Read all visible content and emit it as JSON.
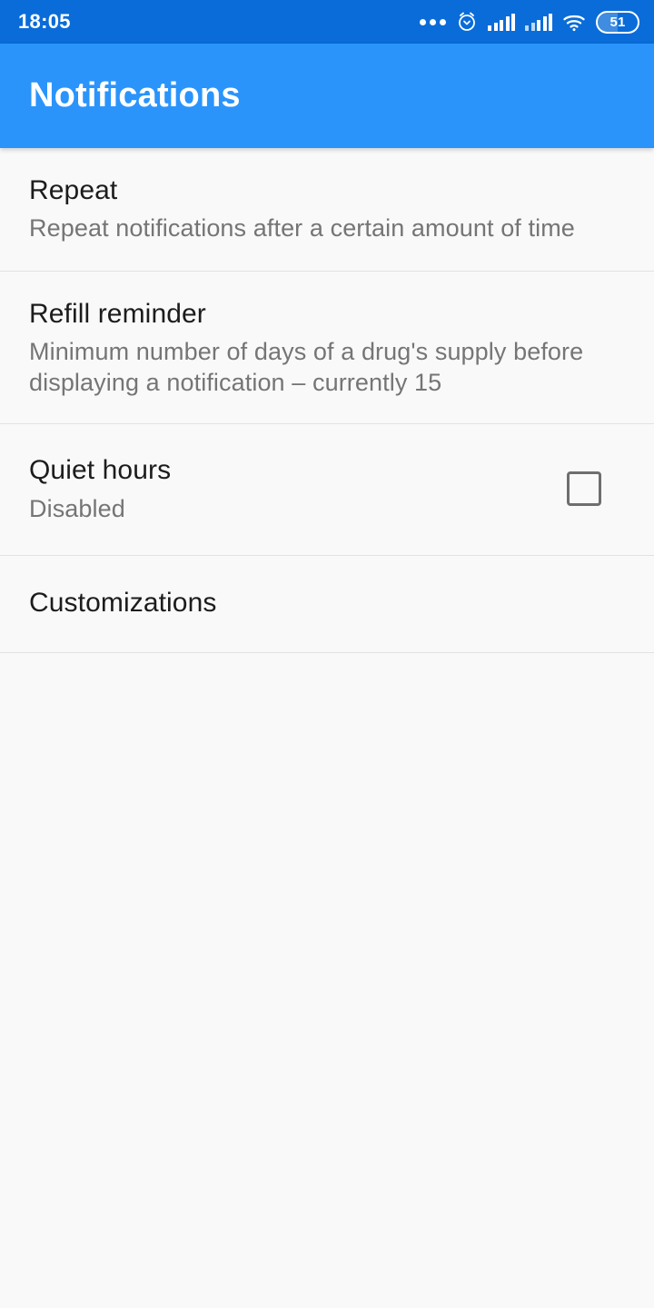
{
  "status_bar": {
    "time": "18:05",
    "battery_level": "51",
    "icons": [
      "more-dots-icon",
      "alarm-icon",
      "signal-icon",
      "signal-icon-secondary",
      "wifi-icon",
      "battery-icon"
    ],
    "background_color": "#0a6cd8"
  },
  "app_bar": {
    "title": "Notifications",
    "background_color": "#2a94fb",
    "text_color": "#ffffff"
  },
  "settings": {
    "items": [
      {
        "title": "Repeat",
        "subtitle": "Repeat notifications after a certain amount of time"
      },
      {
        "title": "Refill reminder",
        "subtitle": "Minimum number of days of a drug's supply before displaying a notification – currently 15"
      },
      {
        "title": "Quiet hours",
        "subtitle": "Disabled",
        "checkbox": "unchecked"
      },
      {
        "title": "Customizations",
        "subtitle": ""
      }
    ]
  },
  "colors": {
    "background": "#f9f9f9",
    "divider": "#e2e2e2",
    "title_text": "#1c1c1c",
    "subtitle_text": "#757575",
    "checkbox_border": "#6e6e6e"
  }
}
